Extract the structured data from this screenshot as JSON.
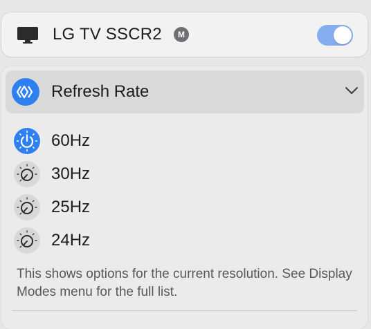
{
  "device": {
    "name": "LG TV SSCR2",
    "badge": "M",
    "enabled": true,
    "icon": "display-icon"
  },
  "menu": {
    "title": "Refresh Rate",
    "icon": "refresh-rate-icon",
    "expanded": true,
    "options": [
      {
        "label": "60Hz",
        "selected": true
      },
      {
        "label": "30Hz",
        "selected": false
      },
      {
        "label": "25Hz",
        "selected": false
      },
      {
        "label": "24Hz",
        "selected": false
      }
    ],
    "note": "This shows options for the current resolution. See Display Modes menu for the full list."
  },
  "colors": {
    "accent": "#2e7ff0",
    "toggle_on": "#85aef0"
  }
}
